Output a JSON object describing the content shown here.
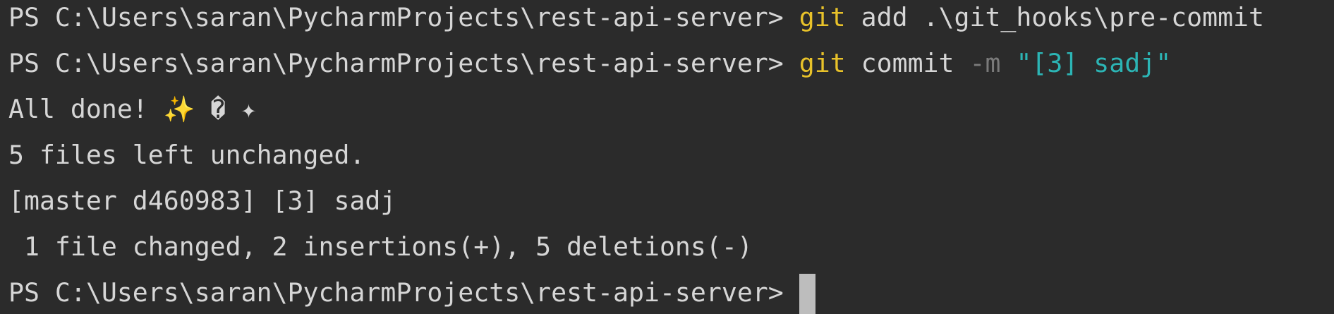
{
  "terminal": {
    "lines": [
      {
        "prompt": "PS C:\\Users\\saran\\PycharmProjects\\rest-api-server>",
        "cmd": "git",
        "args": "add .\\git_hooks\\pre-commit"
      },
      {
        "prompt": "PS C:\\Users\\saran\\PycharmProjects\\rest-api-server>",
        "cmd": "git",
        "args": "commit",
        "flag": "-m",
        "string": "\"[3] sadj\""
      },
      {
        "text": "All done!",
        "sparkles": "✨ � ✦"
      },
      {
        "text": "5 files left unchanged."
      },
      {
        "text": "[master d460983] [3] sadj"
      },
      {
        "text": " 1 file changed, 2 insertions(+), 5 deletions(-)"
      },
      {
        "prompt": "PS C:\\Users\\saran\\PycharmProjects\\rest-api-server>"
      }
    ]
  },
  "colors": {
    "background": "#2b2b2b",
    "text": "#d6d6d6",
    "command": "#e8c22a",
    "flag": "#7a7a7a",
    "string": "#2cb5b5",
    "cursor": "#bdbdbd"
  }
}
